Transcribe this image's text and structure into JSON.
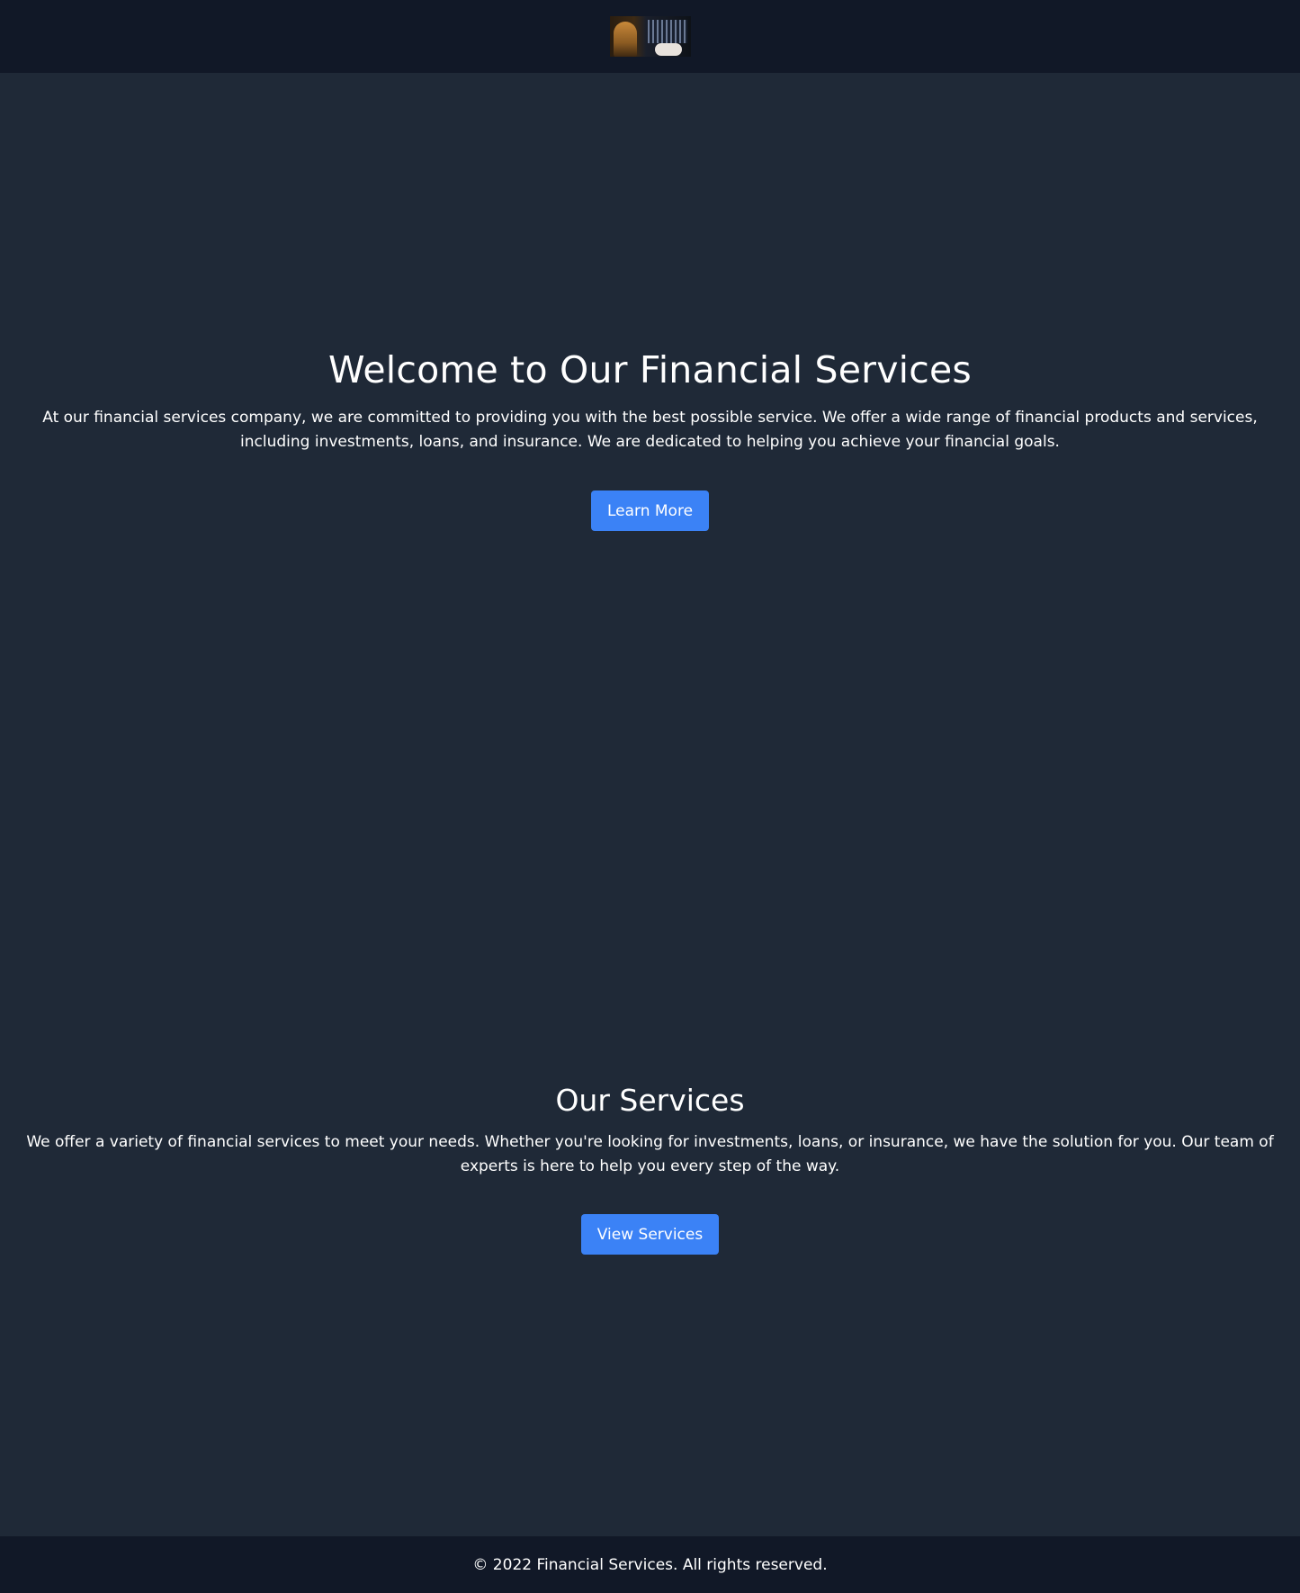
{
  "header": {
    "logo_icon": "finance-photo-logo"
  },
  "hero": {
    "title": "Welcome to Our Financial Services",
    "text": "At our financial services company, we are committed to providing you with the best possible service. We offer a wide range of financial products and services, including investments, loans, and insurance. We are dedicated to helping you achieve your financial goals.",
    "button_label": "Learn More"
  },
  "services": {
    "title": "Our Services",
    "text": "We offer a variety of financial services to meet your needs. Whether you're looking for investments, loans, or insurance, we have the solution for you. Our team of experts is here to help you every step of the way.",
    "button_label": "View Services"
  },
  "footer": {
    "copyright": "© 2022 Financial Services. All rights reserved."
  },
  "colors": {
    "page_bg": "#1f2937",
    "header_bg": "#111827",
    "accent": "#3b82f6",
    "text": "#ffffff"
  }
}
